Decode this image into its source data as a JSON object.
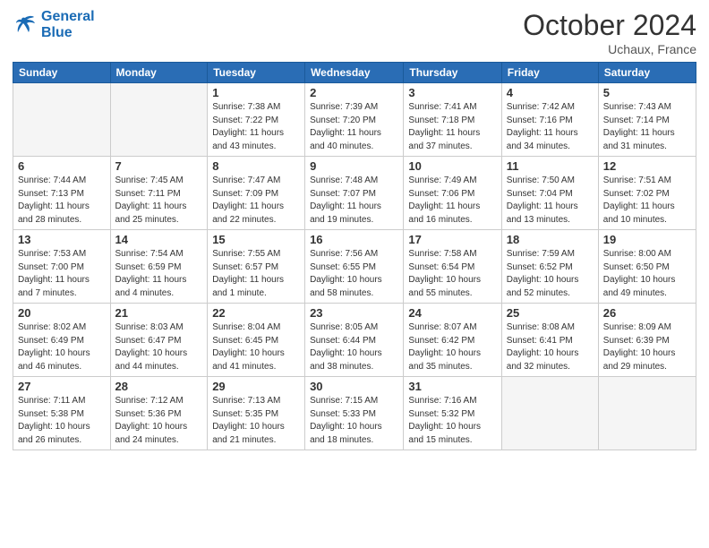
{
  "header": {
    "logo_line1": "General",
    "logo_line2": "Blue",
    "month": "October 2024",
    "location": "Uchaux, France"
  },
  "weekdays": [
    "Sunday",
    "Monday",
    "Tuesday",
    "Wednesday",
    "Thursday",
    "Friday",
    "Saturday"
  ],
  "weeks": [
    [
      {
        "day": "",
        "info": ""
      },
      {
        "day": "",
        "info": ""
      },
      {
        "day": "1",
        "info": "Sunrise: 7:38 AM\nSunset: 7:22 PM\nDaylight: 11 hours\nand 43 minutes."
      },
      {
        "day": "2",
        "info": "Sunrise: 7:39 AM\nSunset: 7:20 PM\nDaylight: 11 hours\nand 40 minutes."
      },
      {
        "day": "3",
        "info": "Sunrise: 7:41 AM\nSunset: 7:18 PM\nDaylight: 11 hours\nand 37 minutes."
      },
      {
        "day": "4",
        "info": "Sunrise: 7:42 AM\nSunset: 7:16 PM\nDaylight: 11 hours\nand 34 minutes."
      },
      {
        "day": "5",
        "info": "Sunrise: 7:43 AM\nSunset: 7:14 PM\nDaylight: 11 hours\nand 31 minutes."
      }
    ],
    [
      {
        "day": "6",
        "info": "Sunrise: 7:44 AM\nSunset: 7:13 PM\nDaylight: 11 hours\nand 28 minutes."
      },
      {
        "day": "7",
        "info": "Sunrise: 7:45 AM\nSunset: 7:11 PM\nDaylight: 11 hours\nand 25 minutes."
      },
      {
        "day": "8",
        "info": "Sunrise: 7:47 AM\nSunset: 7:09 PM\nDaylight: 11 hours\nand 22 minutes."
      },
      {
        "day": "9",
        "info": "Sunrise: 7:48 AM\nSunset: 7:07 PM\nDaylight: 11 hours\nand 19 minutes."
      },
      {
        "day": "10",
        "info": "Sunrise: 7:49 AM\nSunset: 7:06 PM\nDaylight: 11 hours\nand 16 minutes."
      },
      {
        "day": "11",
        "info": "Sunrise: 7:50 AM\nSunset: 7:04 PM\nDaylight: 11 hours\nand 13 minutes."
      },
      {
        "day": "12",
        "info": "Sunrise: 7:51 AM\nSunset: 7:02 PM\nDaylight: 11 hours\nand 10 minutes."
      }
    ],
    [
      {
        "day": "13",
        "info": "Sunrise: 7:53 AM\nSunset: 7:00 PM\nDaylight: 11 hours\nand 7 minutes."
      },
      {
        "day": "14",
        "info": "Sunrise: 7:54 AM\nSunset: 6:59 PM\nDaylight: 11 hours\nand 4 minutes."
      },
      {
        "day": "15",
        "info": "Sunrise: 7:55 AM\nSunset: 6:57 PM\nDaylight: 11 hours\nand 1 minute."
      },
      {
        "day": "16",
        "info": "Sunrise: 7:56 AM\nSunset: 6:55 PM\nDaylight: 10 hours\nand 58 minutes."
      },
      {
        "day": "17",
        "info": "Sunrise: 7:58 AM\nSunset: 6:54 PM\nDaylight: 10 hours\nand 55 minutes."
      },
      {
        "day": "18",
        "info": "Sunrise: 7:59 AM\nSunset: 6:52 PM\nDaylight: 10 hours\nand 52 minutes."
      },
      {
        "day": "19",
        "info": "Sunrise: 8:00 AM\nSunset: 6:50 PM\nDaylight: 10 hours\nand 49 minutes."
      }
    ],
    [
      {
        "day": "20",
        "info": "Sunrise: 8:02 AM\nSunset: 6:49 PM\nDaylight: 10 hours\nand 46 minutes."
      },
      {
        "day": "21",
        "info": "Sunrise: 8:03 AM\nSunset: 6:47 PM\nDaylight: 10 hours\nand 44 minutes."
      },
      {
        "day": "22",
        "info": "Sunrise: 8:04 AM\nSunset: 6:45 PM\nDaylight: 10 hours\nand 41 minutes."
      },
      {
        "day": "23",
        "info": "Sunrise: 8:05 AM\nSunset: 6:44 PM\nDaylight: 10 hours\nand 38 minutes."
      },
      {
        "day": "24",
        "info": "Sunrise: 8:07 AM\nSunset: 6:42 PM\nDaylight: 10 hours\nand 35 minutes."
      },
      {
        "day": "25",
        "info": "Sunrise: 8:08 AM\nSunset: 6:41 PM\nDaylight: 10 hours\nand 32 minutes."
      },
      {
        "day": "26",
        "info": "Sunrise: 8:09 AM\nSunset: 6:39 PM\nDaylight: 10 hours\nand 29 minutes."
      }
    ],
    [
      {
        "day": "27",
        "info": "Sunrise: 7:11 AM\nSunset: 5:38 PM\nDaylight: 10 hours\nand 26 minutes."
      },
      {
        "day": "28",
        "info": "Sunrise: 7:12 AM\nSunset: 5:36 PM\nDaylight: 10 hours\nand 24 minutes."
      },
      {
        "day": "29",
        "info": "Sunrise: 7:13 AM\nSunset: 5:35 PM\nDaylight: 10 hours\nand 21 minutes."
      },
      {
        "day": "30",
        "info": "Sunrise: 7:15 AM\nSunset: 5:33 PM\nDaylight: 10 hours\nand 18 minutes."
      },
      {
        "day": "31",
        "info": "Sunrise: 7:16 AM\nSunset: 5:32 PM\nDaylight: 10 hours\nand 15 minutes."
      },
      {
        "day": "",
        "info": ""
      },
      {
        "day": "",
        "info": ""
      }
    ]
  ]
}
